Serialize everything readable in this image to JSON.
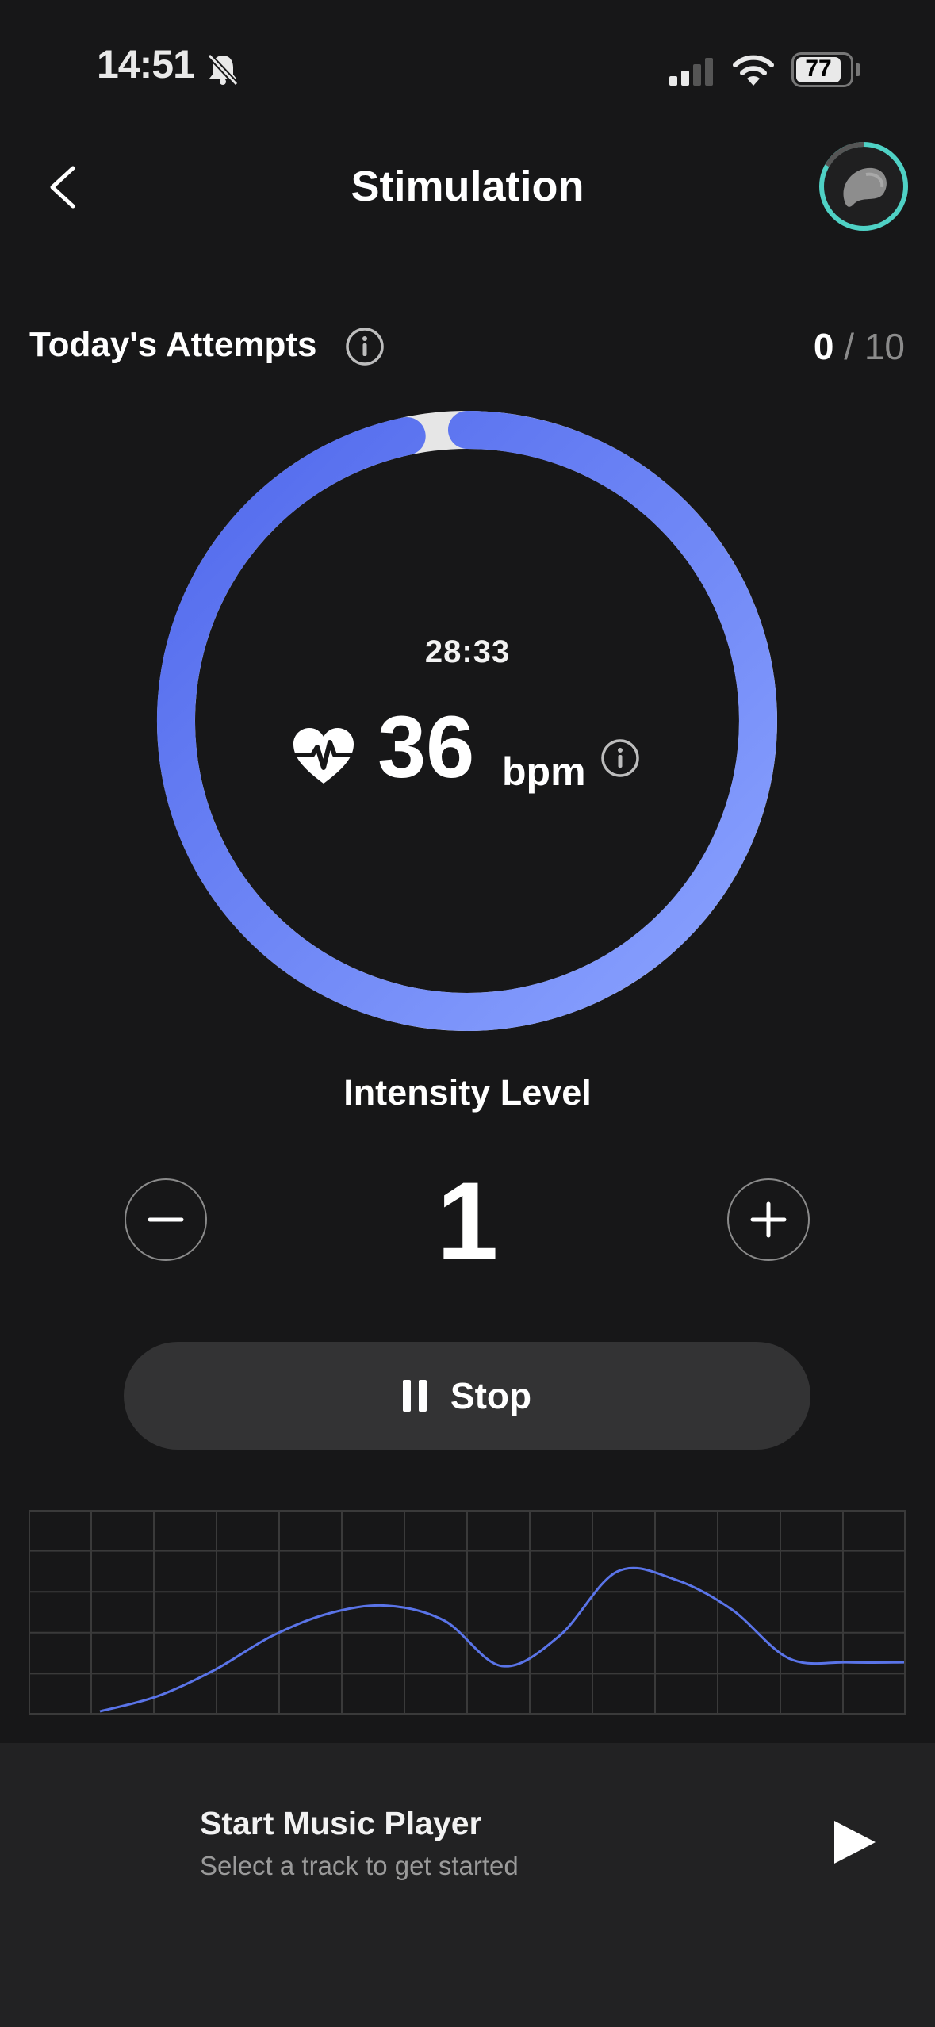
{
  "status_bar": {
    "time": "14:51",
    "battery": "77"
  },
  "header": {
    "title": "Stimulation"
  },
  "attempts": {
    "label": "Today's Attempts",
    "current": "0",
    "separator": " / ",
    "total": "10"
  },
  "session": {
    "timer": "28:33",
    "bpm": "36",
    "bpm_unit": "bpm"
  },
  "intensity": {
    "label": "Intensity Level",
    "value": "1"
  },
  "stop_button": {
    "label": "Stop"
  },
  "music": {
    "title": "Start Music Player",
    "subtitle": "Select a track to get started"
  },
  "colors": {
    "accent": "#5a74e8",
    "accent_light": "#8aa2ff",
    "device_ring": "#4fd1c5",
    "background": "#171718"
  },
  "chart_data": {
    "type": "line",
    "x": [
      0,
      1,
      2,
      3,
      4,
      5,
      6,
      7,
      8,
      9,
      10,
      11,
      12,
      13,
      14
    ],
    "y": [
      0,
      0.08,
      0.22,
      0.4,
      0.52,
      0.56,
      0.48,
      0.24,
      0.4,
      0.74,
      0.7,
      0.54,
      0.28,
      0.26,
      0.26
    ],
    "ylim": [
      0,
      1
    ],
    "grid": true,
    "line_color": "#5a74e8"
  }
}
